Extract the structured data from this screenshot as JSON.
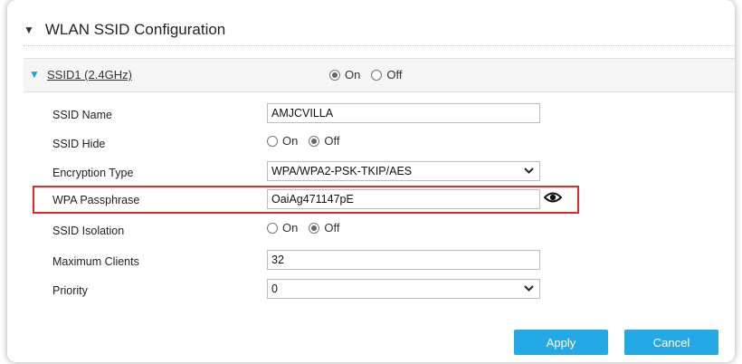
{
  "header": {
    "title": "WLAN SSID Configuration"
  },
  "ssid_bar": {
    "link_label": "SSID1 (2.4GHz)",
    "on_label": "On",
    "off_label": "Off",
    "selected": "On"
  },
  "form": {
    "ssid_name": {
      "label": "SSID Name",
      "value": "AMJCVILLA"
    },
    "ssid_hide": {
      "label": "SSID Hide",
      "on_label": "On",
      "off_label": "Off",
      "selected": "Off"
    },
    "encryption_type": {
      "label": "Encryption Type",
      "value": "WPA/WPA2-PSK-TKIP/AES"
    },
    "wpa_passphrase": {
      "label": "WPA Passphrase",
      "value": "OaiAg471147pE"
    },
    "ssid_isolation": {
      "label": "SSID Isolation",
      "on_label": "On",
      "off_label": "Off",
      "selected": "Off"
    },
    "maximum_clients": {
      "label": "Maximum Clients",
      "value": "32"
    },
    "priority": {
      "label": "Priority",
      "value": "0"
    }
  },
  "buttons": {
    "apply": "Apply",
    "cancel": "Cancel"
  },
  "colors": {
    "accent": "#25a8e6",
    "highlight": "#e0282e",
    "ssid_triangle": "#1aa1e0"
  }
}
